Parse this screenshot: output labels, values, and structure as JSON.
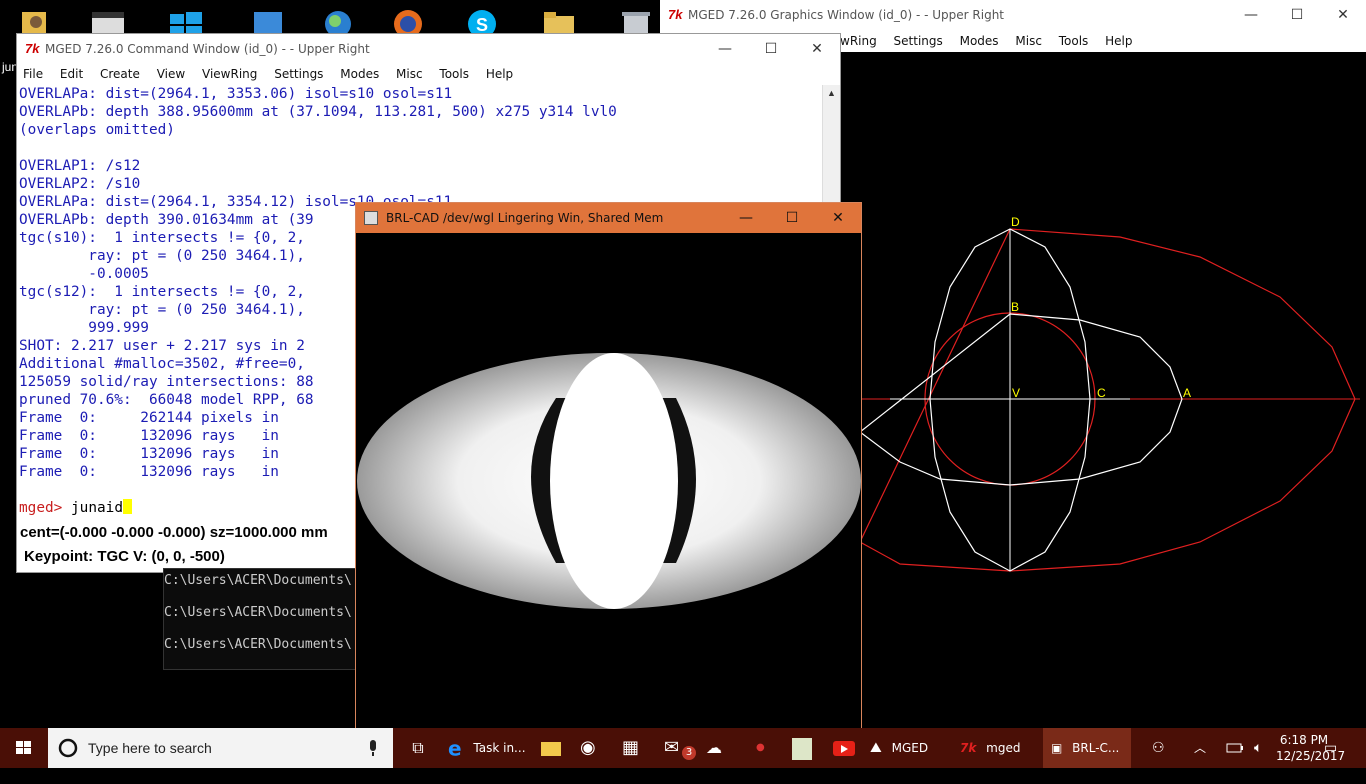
{
  "desktop_icons": [
    "user-folder-icon",
    "movie-icon",
    "windows-logo-icon",
    "monitor-icon",
    "globe-icon",
    "firefox-icon",
    "skype-icon",
    "folder-icon",
    "recycle-bin-icon"
  ],
  "desktop_text": "juna",
  "command_window": {
    "title": "MGED 7.26.0 Command Window (id_0) -  - Upper Right",
    "menu": [
      "File",
      "Edit",
      "Create",
      "View",
      "ViewRing",
      "Settings",
      "Modes",
      "Misc",
      "Tools",
      "Help"
    ],
    "console_lines": [
      "OVERLAPa: dist=(2964.1, 3353.06) isol=s10 osol=s11",
      "OVERLAPb: depth 388.95600mm at (37.1094, 113.281, 500) x275 y314 lvl0",
      "(overlaps omitted)",
      "",
      "OVERLAP1: /s12",
      "OVERLAP2: /s10",
      "OVERLAPa: dist=(2964.1, 3354.12) isol=s10 osol=s11",
      "OVERLAPb: depth 390.01634mm at (39",
      "tgc(s10):  1 intersects != {0, 2,",
      "        ray: pt = (0 250 3464.1),",
      "        -0.0005",
      "tgc(s12):  1 intersects != {0, 2,",
      "        ray: pt = (0 250 3464.1),",
      "        999.999",
      "SHOT: 2.217 user + 2.217 sys in 2",
      "Additional #malloc=3502, #free=0,",
      "125059 solid/ray intersections: 88",
      "pruned 70.6%:  66048 model RPP, 68",
      "Frame  0:     262144 pixels in",
      "Frame  0:     132096 rays   in",
      "Frame  0:     132096 rays   in",
      "Frame  0:     132096 rays   in",
      ""
    ],
    "prompt": "mged>",
    "input": "junaid",
    "status_line": "cent=(-0.000 -0.000 -0.000) sz=1000.000  mm",
    "keypoint_line": "Keypoint: TGC V: (0, 0, -500)"
  },
  "graphics_window": {
    "title": "MGED 7.26.0 Graphics Window (id_0) -  - Upper Right",
    "menu": [
      "wRing",
      "Settings",
      "Modes",
      "Misc",
      "Tools",
      "Help"
    ],
    "labels": {
      "D": "D",
      "B": "B",
      "V": "V",
      "C": "C",
      "A": "A"
    }
  },
  "cmd_prompt": {
    "lines": [
      "C:\\Users\\ACER\\Documents\\",
      "C:\\Users\\ACER\\Documents\\",
      "C:\\Users\\ACER\\Documents\\"
    ]
  },
  "brl_window": {
    "title": "BRL-CAD /dev/wgl Lingering Win, Shared Mem"
  },
  "taskbar": {
    "search_placeholder": "Type here to search",
    "task_label": "Task in...",
    "mail_badge": "3",
    "mged1": "MGED",
    "mged2": "mged",
    "brlcad": "BRL-C...",
    "time": "6:18 PM",
    "date": "12/25/2017"
  },
  "colors": {
    "console_text": "#1c1cb4",
    "prompt": "#c81e1e",
    "taskbar": "#4a0f06",
    "brl_title": "#e0743b",
    "wire_red": "#e02020",
    "wire_white": "#ffffff",
    "label_yellow": "#ffff00"
  }
}
